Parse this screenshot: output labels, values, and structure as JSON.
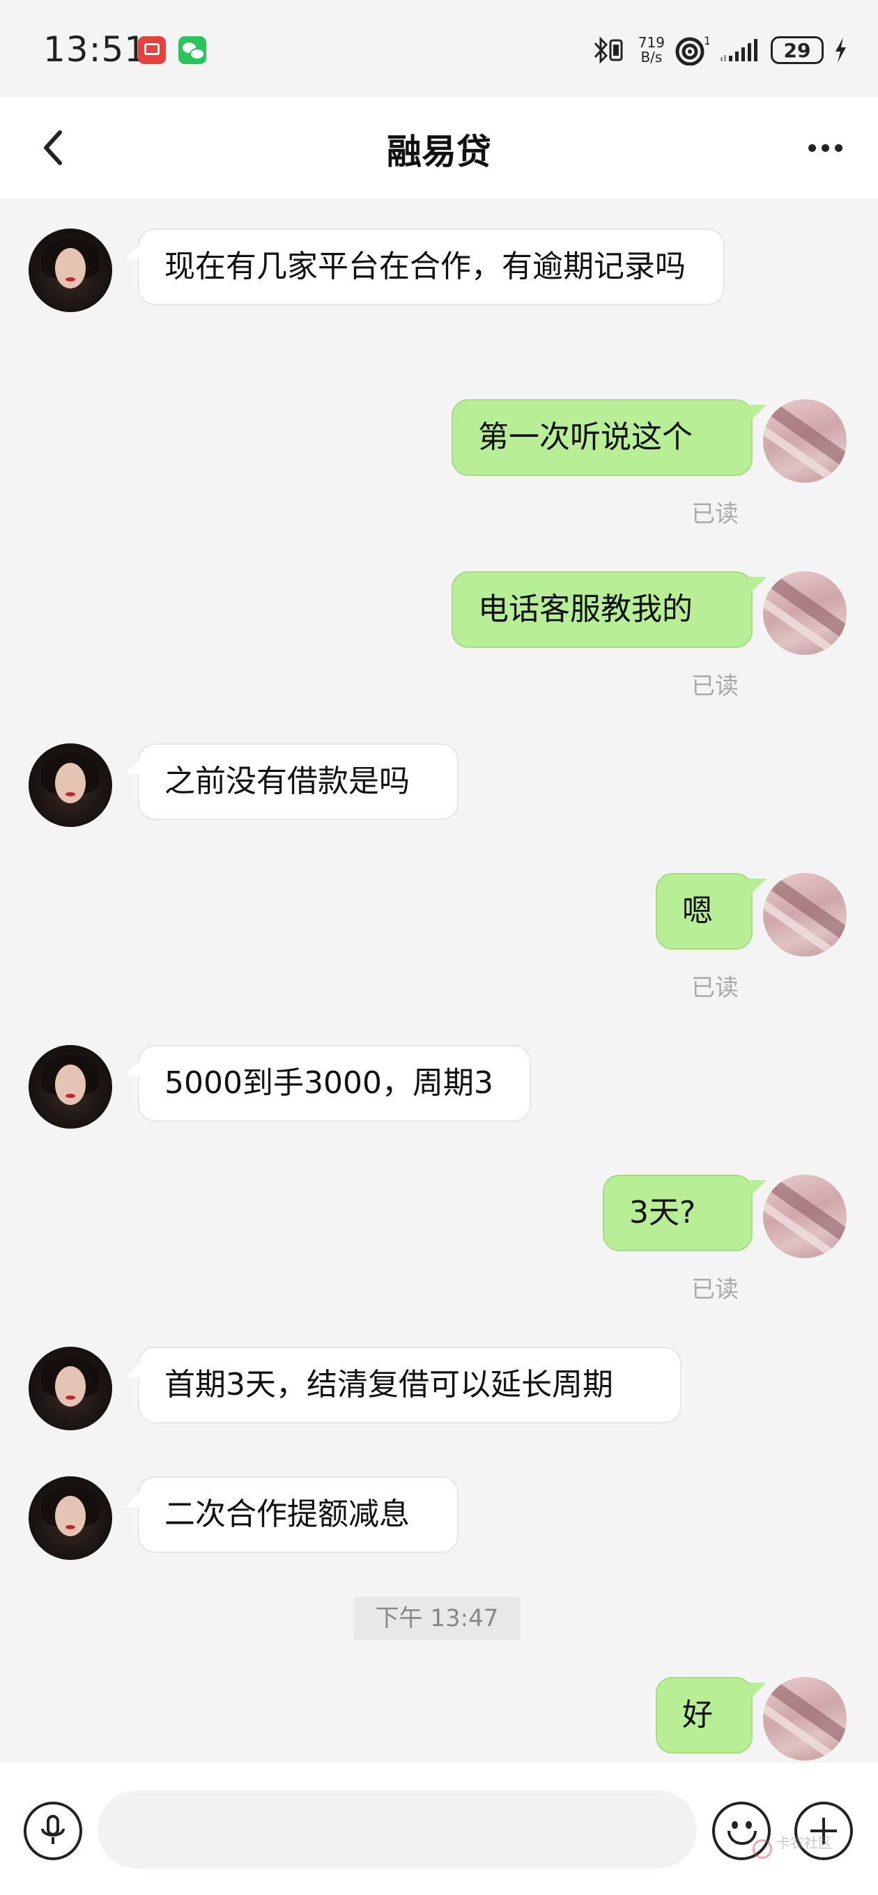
{
  "status_bar": {
    "time": "13:51",
    "speed_top": "719",
    "speed_bottom": "B/s",
    "battery": "29",
    "wifi_badge": "1"
  },
  "header": {
    "title": "融易贷"
  },
  "messages": [
    {
      "side": "in",
      "text": "现在有几家平台在合作，有逾期记录吗"
    },
    {
      "side": "out",
      "text": "第一次听说这个",
      "status": "已读"
    },
    {
      "side": "out",
      "text": "电话客服教我的",
      "status": "已读"
    },
    {
      "side": "in",
      "text": "之前没有借款是吗"
    },
    {
      "side": "out",
      "text": "嗯",
      "status": "已读"
    },
    {
      "side": "in",
      "text": "5000到手3000，周期3"
    },
    {
      "side": "out",
      "text": "3天?",
      "status": "已读"
    },
    {
      "side": "in",
      "text": "首期3天，结清复借可以延长周期"
    },
    {
      "side": "in",
      "text": "二次合作提额减息"
    },
    {
      "side": "out",
      "text": "好"
    }
  ],
  "timestamp": "下午 13:47",
  "input": {
    "placeholder": ""
  },
  "watermark": {
    "line1": "卡农社区"
  }
}
